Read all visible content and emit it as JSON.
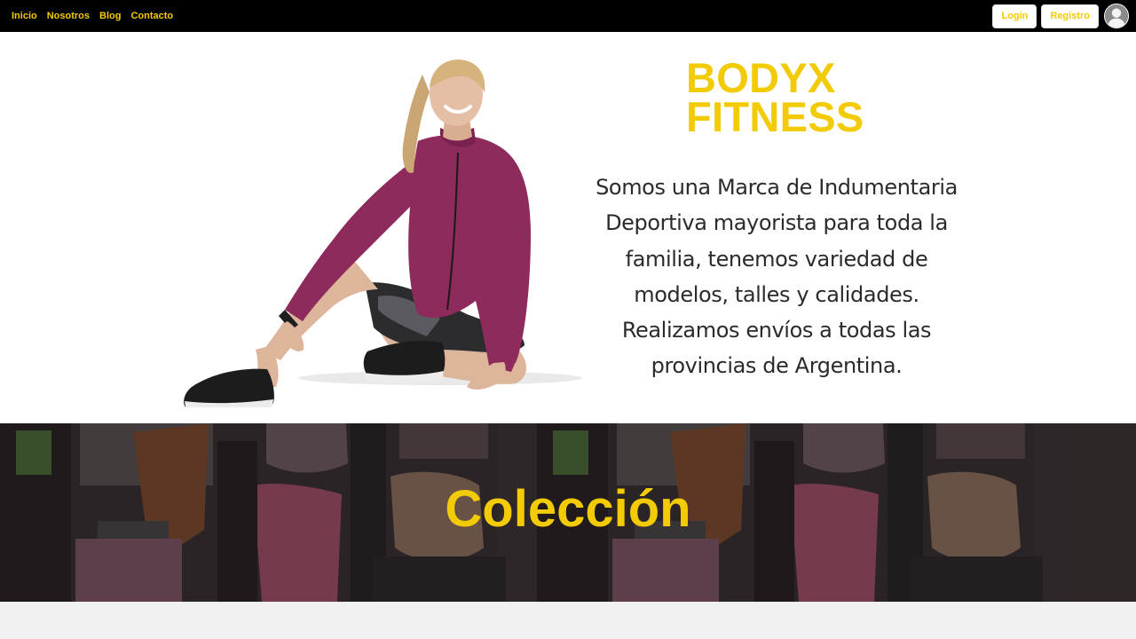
{
  "nav": {
    "links": [
      "Inicio",
      "Nosotros",
      "Blog",
      "Contacto"
    ],
    "login_label": "Login",
    "register_label": "Registro",
    "avatar_icon": "user-avatar-icon"
  },
  "hero": {
    "brand_line1": "BODYX",
    "brand_line2": "FITNESS",
    "description": "Somos una Marca de Indumentaria Deportiva mayorista para toda la familia, tenemos variedad de modelos, talles y calidades. Realizamos envíos a todas las provincias de Argentina."
  },
  "collection": {
    "title": "Colección"
  },
  "colors": {
    "accent": "#f2cb05",
    "navbar": "#000000",
    "text": "#2b2b2b",
    "footer": "#f0f0f0"
  }
}
